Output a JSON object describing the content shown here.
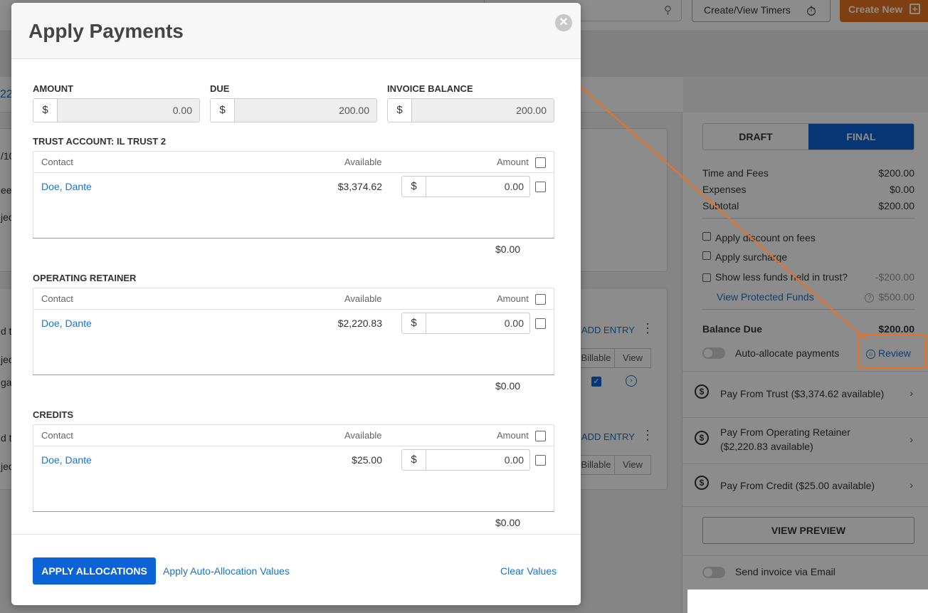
{
  "topbar": {
    "timers_label": "Create/View Timers",
    "create_label": "Create New"
  },
  "background": {
    "crumb_fragment": "22",
    "left_fragments": [
      "/10",
      "ee,",
      "jec",
      "d t",
      "jec",
      "gal",
      "d t",
      "jec"
    ],
    "add_entry_label": "ADD ENTRY",
    "billable_label": "Billable",
    "view_label": "View"
  },
  "side": {
    "tabs": {
      "draft": "DRAFT",
      "final": "FINAL"
    },
    "summary": [
      {
        "label": "Time and Fees",
        "value": "$200.00"
      },
      {
        "label": "Expenses",
        "value": "$0.00"
      },
      {
        "label": "Subtotal",
        "value": "$200.00"
      }
    ],
    "options": [
      {
        "label": "Apply discount on fees"
      },
      {
        "label": "Apply surcharge"
      },
      {
        "label": "Show less funds held in trust?",
        "value": "-$200.00"
      }
    ],
    "protected_funds": {
      "label": "View Protected Funds",
      "value": "$500.00"
    },
    "balance_due": {
      "label": "Balance Due",
      "value": "$200.00"
    },
    "auto_allocate_label": "Auto-allocate payments",
    "review_label": "Review",
    "pay_from": [
      {
        "label": "Pay From Trust ($3,374.62 available)"
      },
      {
        "label": "Pay From Operating Retainer",
        "label2": "($2,220.83 available)"
      },
      {
        "label": "Pay From Credit ($25.00 available)"
      }
    ],
    "preview_label": "VIEW PREVIEW",
    "send_email_label": "Send invoice via Email"
  },
  "modal": {
    "title": "Apply Payments",
    "fields": [
      {
        "label": "AMOUNT",
        "currency": "$",
        "value": "0.00"
      },
      {
        "label": "DUE",
        "currency": "$",
        "value": "200.00"
      },
      {
        "label": "INVOICE BALANCE",
        "currency": "$",
        "value": "200.00"
      }
    ],
    "columns": {
      "contact": "Contact",
      "available": "Available",
      "amount": "Amount"
    },
    "sections": [
      {
        "title": "TRUST ACCOUNT: IL TRUST 2",
        "contact": "Doe, Dante",
        "available": "$3,374.62",
        "currency": "$",
        "amount": "0.00",
        "total": "$0.00"
      },
      {
        "title": "OPERATING RETAINER",
        "contact": "Doe, Dante",
        "available": "$2,220.83",
        "currency": "$",
        "amount": "0.00",
        "total": "$0.00"
      },
      {
        "title": "CREDITS",
        "contact": "Doe, Dante",
        "available": "$25.00",
        "currency": "$",
        "amount": "0.00",
        "total": "$0.00"
      }
    ],
    "footer": {
      "apply_label": "APPLY ALLOCATIONS",
      "auto_label": "Apply Auto-Allocation Values",
      "clear_label": "Clear Values"
    }
  },
  "colors": {
    "primary": "#0b63d6",
    "accent_orange": "#f07021",
    "link": "#1a73c9"
  }
}
